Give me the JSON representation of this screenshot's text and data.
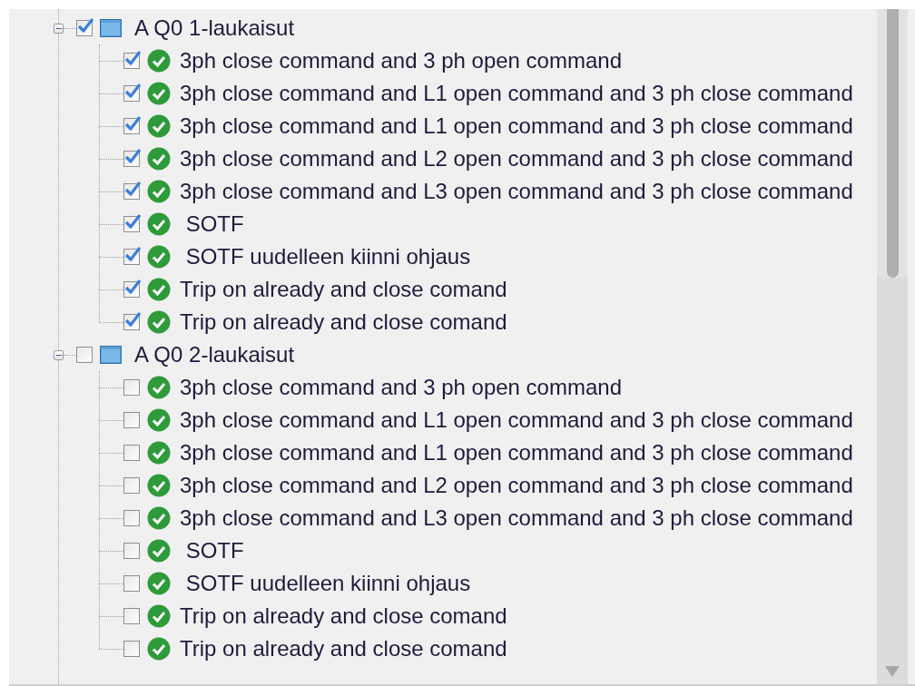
{
  "tree": [
    {
      "label": "A Q0 1-laukaisut",
      "expanded": true,
      "checked": true,
      "children": [
        {
          "label": "3ph close command and 3 ph open command",
          "checked": true,
          "passed": true
        },
        {
          "label": "3ph close command and L1 open command and 3 ph close command",
          "checked": true,
          "passed": true
        },
        {
          "label": "3ph close command and L1 open command and 3 ph close command",
          "checked": true,
          "passed": true
        },
        {
          "label": "3ph close command and L2 open command and 3 ph close command",
          "checked": true,
          "passed": true
        },
        {
          "label": "3ph close command and L3 open command and 3 ph close command",
          "checked": true,
          "passed": true
        },
        {
          "label": " SOTF",
          "checked": true,
          "passed": true
        },
        {
          "label": " SOTF uudelleen kiinni ohjaus",
          "checked": true,
          "passed": true
        },
        {
          "label": "Trip on already and close comand",
          "checked": true,
          "passed": true
        },
        {
          "label": "Trip on already and close comand",
          "checked": true,
          "passed": true
        }
      ]
    },
    {
      "label": "A Q0 2-laukaisut",
      "expanded": true,
      "checked": false,
      "children": [
        {
          "label": "3ph close command and 3 ph open command",
          "checked": false,
          "passed": true
        },
        {
          "label": "3ph close command and L1 open command and 3 ph close command",
          "checked": false,
          "passed": true
        },
        {
          "label": "3ph close command and L1 open command and 3 ph close command",
          "checked": false,
          "passed": true
        },
        {
          "label": "3ph close command and L2 open command and 3 ph close command",
          "checked": false,
          "passed": true
        },
        {
          "label": "3ph close command and L3 open command and 3 ph close command",
          "checked": false,
          "passed": true
        },
        {
          "label": " SOTF",
          "checked": false,
          "passed": true
        },
        {
          "label": " SOTF uudelleen kiinni ohjaus",
          "checked": false,
          "passed": true
        },
        {
          "label": "Trip on already and close comand",
          "checked": false,
          "passed": true
        },
        {
          "label": "Trip on already and close comand",
          "checked": false,
          "passed": true
        }
      ]
    }
  ]
}
